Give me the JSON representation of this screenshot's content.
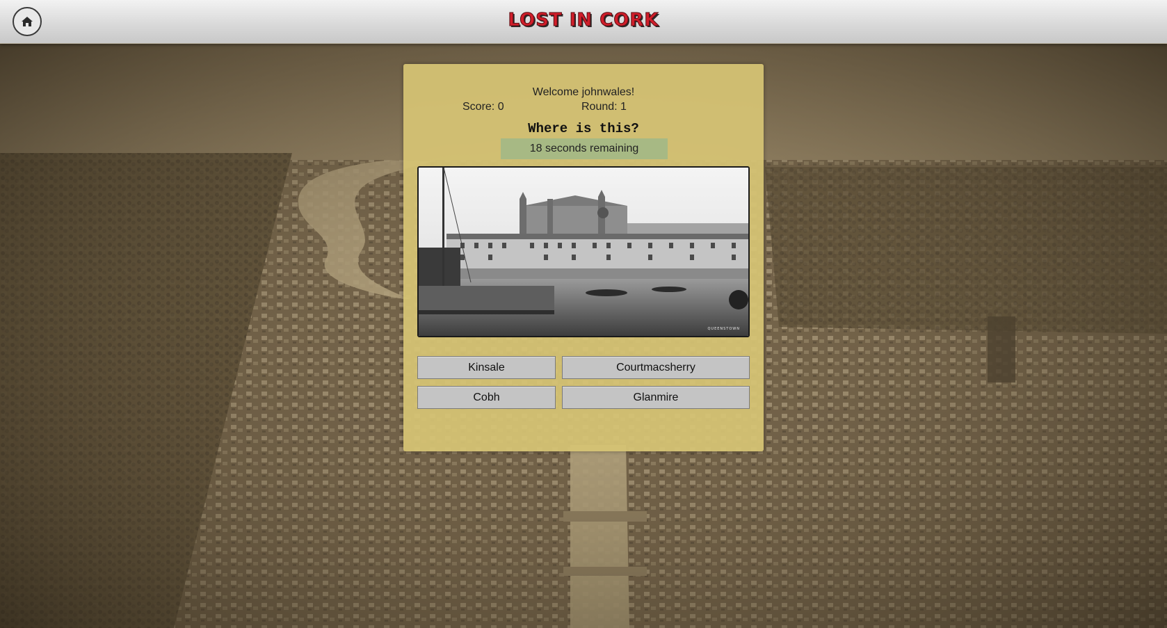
{
  "header": {
    "logo_text": "LOST IN CORK",
    "home_icon": "home-icon"
  },
  "game": {
    "welcome": "Welcome johnwales!",
    "score": "Score: 0",
    "round": "Round: 1",
    "question": "Where is this?",
    "timer": "18 seconds remaining",
    "photo_caption": "QUEENSTOWN"
  },
  "answers": [
    {
      "label": "Kinsale"
    },
    {
      "label": "Courtmacsherry"
    },
    {
      "label": "Cobh"
    },
    {
      "label": "Glanmire"
    }
  ],
  "colors": {
    "card": "#d6c474",
    "timer": "#a7b984",
    "answer_button": "#c4c4c4",
    "logo_red": "#d01e2a"
  }
}
